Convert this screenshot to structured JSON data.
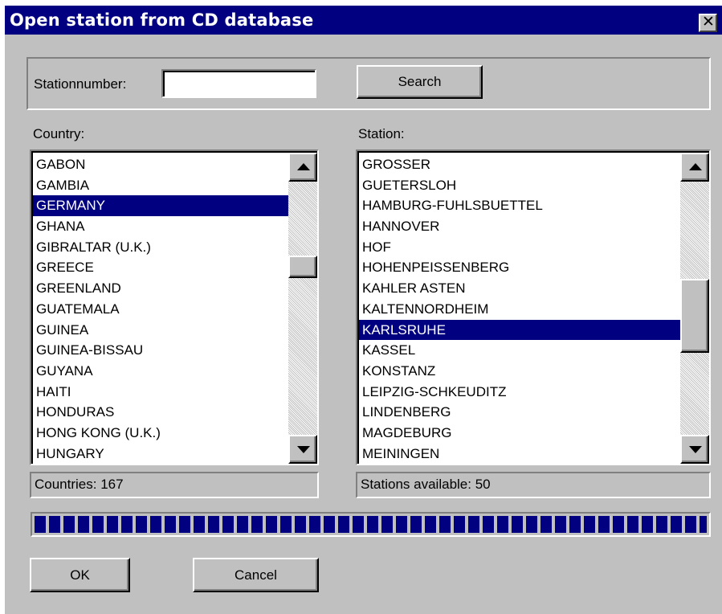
{
  "window": {
    "title": "Open station from CD database",
    "close_glyph": "✕"
  },
  "search": {
    "label": "Stationnumber:",
    "value": "",
    "button_label": "Search"
  },
  "country": {
    "label": "Country:",
    "items": [
      "GABON",
      "GAMBIA",
      "GERMANY",
      "GHANA",
      "GIBRALTAR (U.K.)",
      "GREECE",
      "GREENLAND",
      "GUATEMALA",
      "GUINEA",
      "GUINEA-BISSAU",
      "GUYANA",
      "HAITI",
      "HONDURAS",
      "HONG KONG (U.K.)",
      "HUNGARY"
    ],
    "selected": "GERMANY",
    "status": "Countries: 167"
  },
  "station": {
    "label": "Station:",
    "items": [
      "GROSSER",
      "GUETERSLOH",
      "HAMBURG-FUHLSBUETTEL",
      "HANNOVER",
      "HOF",
      "HOHENPEISSENBERG",
      "KAHLER ASTEN",
      "KALTENNORDHEIM",
      "KARLSRUHE",
      "KASSEL",
      "KONSTANZ",
      "LEIPZIG-SCHKEUDITZ",
      "LINDENBERG",
      "MAGDEBURG",
      "MEININGEN"
    ],
    "selected": "KARLSRUHE",
    "status": "Stations available: 50"
  },
  "progress": {
    "value": 1.0
  },
  "buttons": {
    "ok_label": "OK",
    "cancel_label": "Cancel"
  },
  "colors": {
    "titlebar": "#000080",
    "selection": "#000080",
    "face": "#c0c0c0"
  },
  "icons": {
    "close": "close-icon",
    "scroll_up": "scroll-up-arrow-icon",
    "scroll_down": "scroll-down-arrow-icon"
  }
}
